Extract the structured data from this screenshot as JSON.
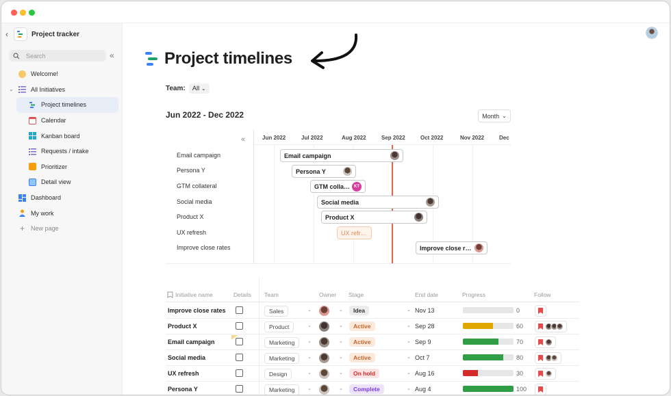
{
  "app": {
    "title": "Project tracker"
  },
  "search": {
    "placeholder": "Search"
  },
  "nav": {
    "items": [
      {
        "label": "Welcome!"
      },
      {
        "label": "All Initiatives"
      },
      {
        "label": "Project timelines"
      },
      {
        "label": "Calendar"
      },
      {
        "label": "Kanban board"
      },
      {
        "label": "Requests / intake"
      },
      {
        "label": "Prioritizer"
      },
      {
        "label": "Detail view"
      },
      {
        "label": "Dashboard"
      },
      {
        "label": "My work"
      },
      {
        "label": "New page"
      }
    ]
  },
  "page": {
    "title": "Project timelines"
  },
  "filter": {
    "team_label": "Team:",
    "team_value": "All"
  },
  "timeline": {
    "range": "Jun 2022 - Dec 2022",
    "view": "Month",
    "months": [
      "Jun 2022",
      "Jul 2022",
      "Aug 2022",
      "Sep 2022",
      "Oct 2022",
      "Nov 2022",
      "Dec"
    ],
    "rows": [
      {
        "label": "Email campaign",
        "bar": "Email campaign"
      },
      {
        "label": "Persona Y",
        "bar": "Persona Y"
      },
      {
        "label": "GTM collateral",
        "bar": "GTM colla…",
        "avatar_initials": "KT"
      },
      {
        "label": "Social media",
        "bar": "Social media"
      },
      {
        "label": "Product X",
        "bar": "Product X"
      },
      {
        "label": "UX refresh",
        "bar": "UX refr…"
      },
      {
        "label": "Improve close rates",
        "bar": "Improve close r…"
      }
    ]
  },
  "table": {
    "headers": {
      "name": "Initiative name",
      "details": "Details",
      "team": "Team",
      "owner": "Owner",
      "stage": "Stage",
      "end": "End date",
      "progress": "Progress",
      "follow": "Follow"
    },
    "rows": [
      {
        "name": "Improve close rates",
        "team": "Sales",
        "stage": "Idea",
        "end": "Nov 13",
        "progress": 0,
        "progress_label": "0"
      },
      {
        "name": "Product X",
        "team": "Product",
        "stage": "Active",
        "end": "Sep 28",
        "progress": 60,
        "progress_label": "60"
      },
      {
        "name": "Email campaign",
        "team": "Marketing",
        "stage": "Active",
        "end": "Sep 9",
        "progress": 70,
        "progress_label": "70"
      },
      {
        "name": "Social media",
        "team": "Marketing",
        "stage": "Active",
        "end": "Oct 7",
        "progress": 80,
        "progress_label": "80"
      },
      {
        "name": "UX refresh",
        "team": "Design",
        "stage": "On hold",
        "end": "Aug 16",
        "progress": 30,
        "progress_label": "30"
      },
      {
        "name": "Persona Y",
        "team": "Marketing",
        "stage": "Complete",
        "end": "Aug 4",
        "progress": 100,
        "progress_label": "100"
      }
    ]
  },
  "colors": {
    "accent": "#e84b4b",
    "progress_yellow": "#e0a800",
    "progress_green": "#2f9e44",
    "progress_red": "#d42a2a",
    "today_line": "#e06a4a"
  }
}
